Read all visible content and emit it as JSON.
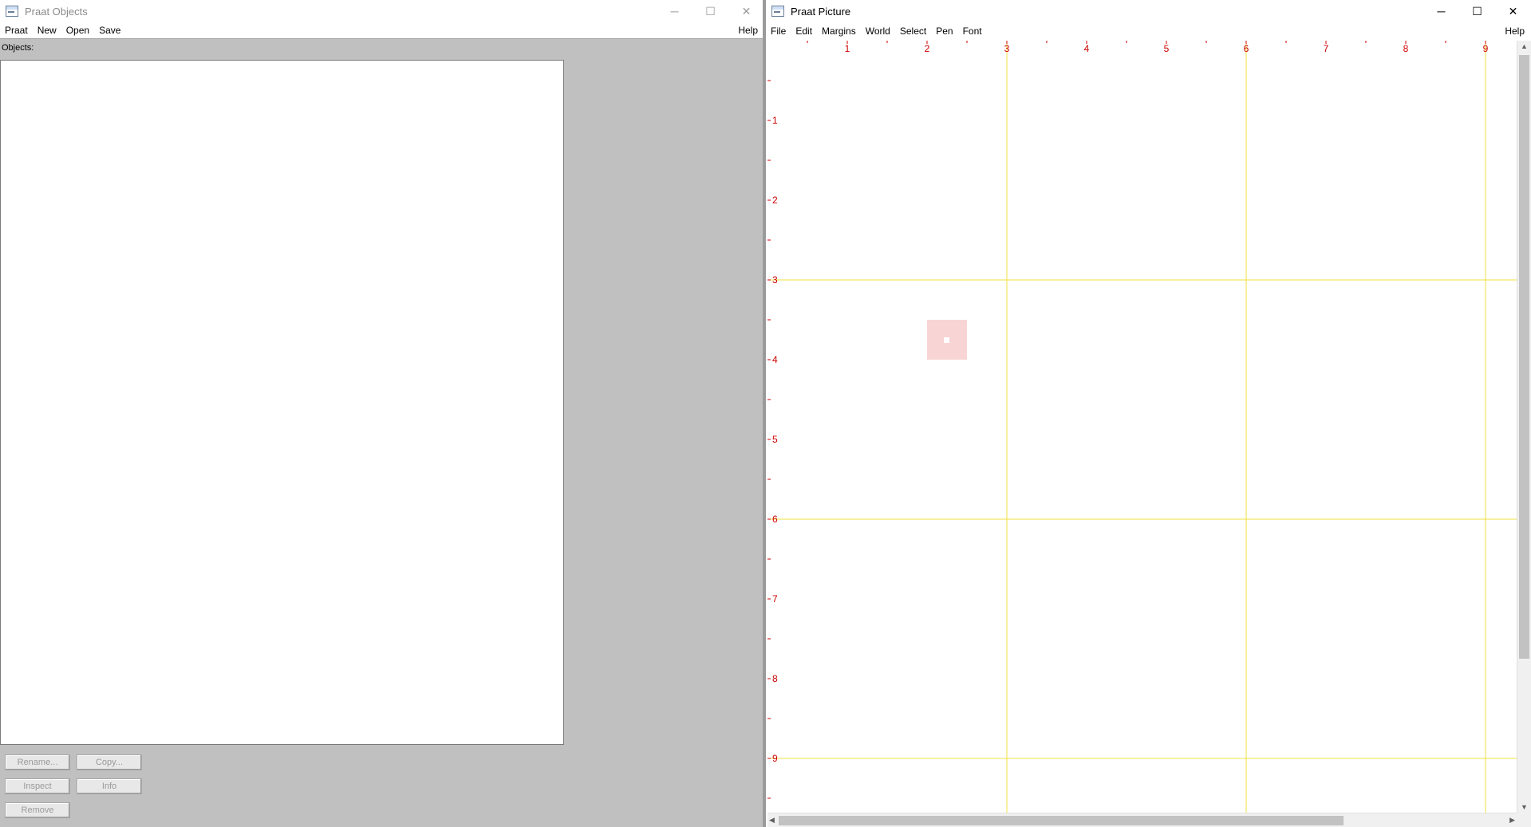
{
  "objects_window": {
    "title": "Praat Objects",
    "menus": [
      "Praat",
      "New",
      "Open",
      "Save"
    ],
    "help": "Help",
    "objects_label": "Objects:",
    "buttons": {
      "rename": "Rename...",
      "copy": "Copy...",
      "inspect": "Inspect",
      "info": "Info",
      "remove": "Remove"
    }
  },
  "picture_window": {
    "title": "Praat Picture",
    "menus": [
      "File",
      "Edit",
      "Margins",
      "World",
      "Select",
      "Pen",
      "Font"
    ],
    "help": "Help",
    "ruler": {
      "top_labels": [
        "1",
        "2",
        "3",
        "4",
        "5",
        "6",
        "7",
        "8",
        "9"
      ],
      "left_labels": [
        "1",
        "2",
        "3",
        "4",
        "5",
        "6",
        "7",
        "8",
        "9"
      ],
      "color": "#cc0000"
    },
    "guide_color": "#f0e040",
    "selection_color": "#f8d4d4"
  },
  "window_controls": {
    "minimize": "─",
    "maximize": "☐",
    "close": "✕"
  }
}
